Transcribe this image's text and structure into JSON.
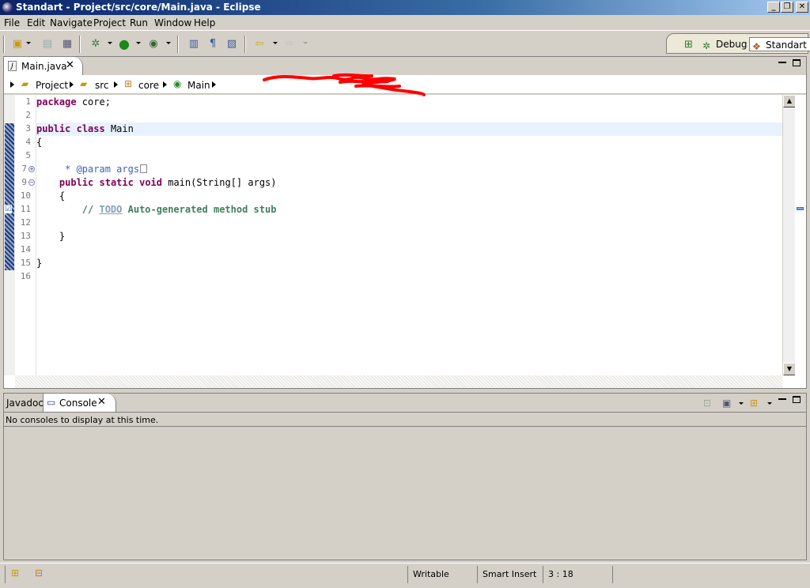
{
  "window": {
    "title": "Standart - Project/src/core/Main.java - Eclipse",
    "min": "_",
    "restore": "❐",
    "close": "✕"
  },
  "menu": [
    "File",
    "Edit",
    "Navigate",
    "Project",
    "Run",
    "Window",
    "Help"
  ],
  "toolbar": {
    "icons": [
      "new-icon",
      "save-icon",
      "print-icon",
      "debug-icon",
      "run-icon",
      "external-tools-icon",
      "open-type-icon",
      "toggle-mark-icon",
      "show-whitespace-icon",
      "back-icon",
      "forward-icon"
    ]
  },
  "perspectives": {
    "open_icon": "open-perspective-icon",
    "debug": "Debug",
    "standart": "Standart"
  },
  "editor": {
    "tab_label": "Main.java",
    "tab_icon": "J",
    "close": "✕",
    "breadcrumb": [
      "Project",
      "src",
      "core",
      "Main"
    ],
    "lines": [
      "1",
      "2",
      "3",
      "4",
      "5",
      "7",
      "9",
      "10",
      "11",
      "12",
      "13",
      "14",
      "15",
      "16"
    ],
    "code": {
      "l1_kw": "package",
      "l1_rest": " core;",
      "l3_kw1": "public",
      "l3_kw2": "class",
      "l3_rest": " Main",
      "l4": "{",
      "l7": "     * @param args",
      "l9_indent": "    ",
      "l9_kw1": "public",
      "l9_kw2": "static",
      "l9_kw3": "void",
      "l9_rest": " main(String[] args)",
      "l10": "    {",
      "l11_indent": "        ",
      "l11_slash": "// ",
      "l11_todo": "TODO",
      "l11_rest": " Auto-generated method stub",
      "l13": "    }",
      "l15": "}"
    }
  },
  "console": {
    "tab_javadoc": "Javadoc",
    "tab_console": "Console",
    "close": "✕",
    "message": "No consoles to display at this time."
  },
  "status": {
    "writable": "Writable",
    "insert_mode": "Smart Insert",
    "position": "3 : 18"
  },
  "colors": {
    "keyword": "#7f0055",
    "javadoc": "#3f5fbf",
    "comment": "#3f7f5f",
    "current_line": "#e8f2fe",
    "scribble": "#ff0000"
  }
}
